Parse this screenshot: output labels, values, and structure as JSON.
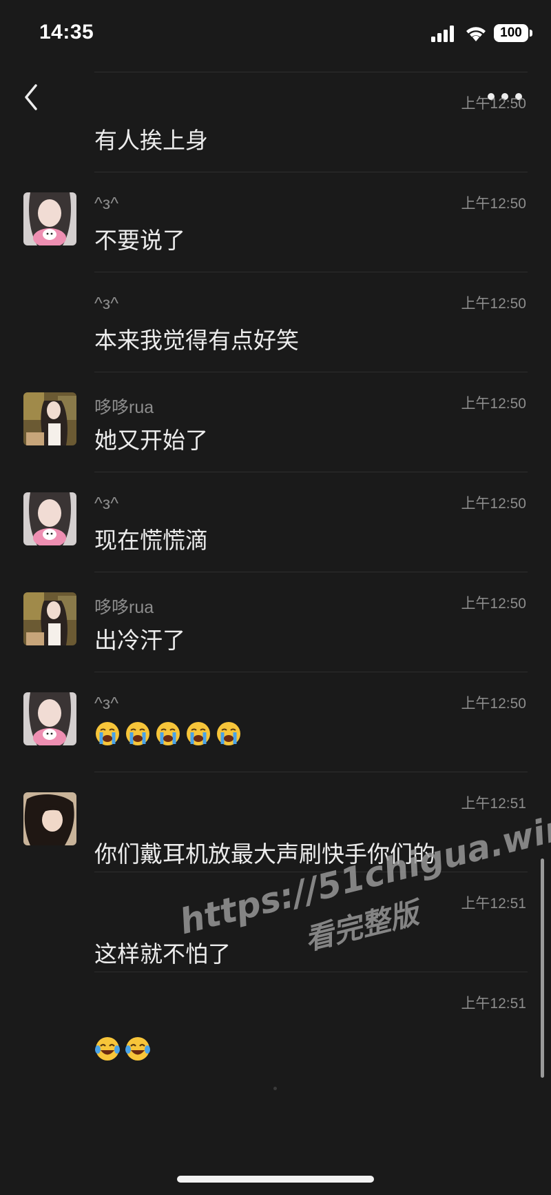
{
  "status_bar": {
    "time": "14:35",
    "battery": "100"
  },
  "messages": [
    {
      "sender": "",
      "time": "上午12:50",
      "text": "有人挨上身",
      "avatar": ""
    },
    {
      "sender": "^з^",
      "time": "上午12:50",
      "text": "不要说了",
      "avatar": "girl-plush"
    },
    {
      "sender": "^з^",
      "time": "上午12:50",
      "text": "本来我觉得有点好笑",
      "avatar": ""
    },
    {
      "sender": "哆哆rua",
      "time": "上午12:50",
      "text": "她又开始了",
      "avatar": "girl-cafe"
    },
    {
      "sender": "^з^",
      "time": "上午12:50",
      "text": "现在慌慌滴",
      "avatar": "girl-plush"
    },
    {
      "sender": "哆哆rua",
      "time": "上午12:50",
      "text": "出冷汗了",
      "avatar": "girl-cafe"
    },
    {
      "sender": "^з^",
      "time": "上午12:50",
      "emoji": [
        "loudly-crying-face",
        "loudly-crying-face",
        "loudly-crying-face",
        "loudly-crying-face",
        "loudly-crying-face"
      ],
      "avatar": "girl-plush"
    },
    {
      "sender": "",
      "time": "上午12:51",
      "text": "你们戴耳机放最大声刷快手你们的",
      "avatar": "girl-dark-hair"
    },
    {
      "sender": "",
      "time": "上午12:51",
      "text": "这样就不怕了",
      "avatar": ""
    },
    {
      "sender": "",
      "time": "上午12:51",
      "emoji": [
        "face-with-tears-of-joy",
        "face-with-tears-of-joy"
      ],
      "avatar": ""
    }
  ],
  "watermark": {
    "url": "https://51chigua.win",
    "label": "看完整版"
  },
  "colors": {
    "background": "#1a1a1a",
    "text": "#ececec",
    "secondary": "#8d8d8d"
  }
}
